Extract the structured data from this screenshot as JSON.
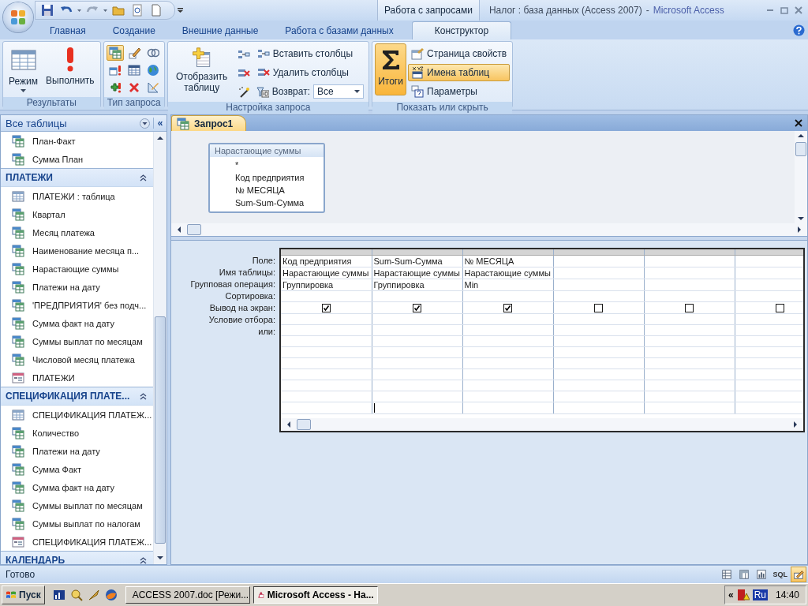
{
  "window": {
    "title": "Налог : база данных (Access 2007)",
    "separator": "-",
    "app": "Microsoft Access"
  },
  "context_group": "Работа с запросами",
  "tabs": [
    {
      "label": "Главная",
      "selected": false
    },
    {
      "label": "Создание",
      "selected": false
    },
    {
      "label": "Внешние данные",
      "selected": false
    },
    {
      "label": "Работа с базами данных",
      "selected": false
    },
    {
      "label": "Конструктор",
      "selected": true
    }
  ],
  "ribbon": [
    {
      "title": "Результаты",
      "controls": [
        {
          "kind": "large",
          "label": "Режим",
          "dropdown": true,
          "selected": false
        },
        {
          "kind": "large",
          "label": "Выполнить",
          "selected": false
        }
      ]
    },
    {
      "title": "Тип запроса",
      "controls": [
        {
          "kind": "icongrid",
          "items": [
            {
              "selected": true
            },
            {
              "selected": false
            },
            {
              "selected": false
            },
            {
              "selected": false
            },
            {
              "selected": false
            },
            {
              "selected": false
            },
            {
              "selected": false
            },
            {
              "selected": false
            },
            {
              "selected": false
            }
          ]
        }
      ]
    },
    {
      "title": "Настройка запроса",
      "controls": [
        {
          "kind": "large",
          "label": "Отобразить таблицу",
          "selected": false
        },
        {
          "kind": "iconcol",
          "items": [
            {
              "selected": false
            },
            {
              "selected": false
            },
            {
              "selected": false
            }
          ]
        },
        {
          "kind": "stack",
          "items": [
            {
              "kind": "small",
              "label": "Вставить столбцы",
              "selected": false
            },
            {
              "kind": "small",
              "label": "Удалить столбцы",
              "selected": false
            },
            {
              "kind": "combo",
              "label": "Возврат:",
              "value": "Все"
            }
          ]
        }
      ]
    },
    {
      "title": "Показать или скрыть",
      "controls": [
        {
          "kind": "large",
          "label": "Итоги",
          "selected": true
        },
        {
          "kind": "stack",
          "items": [
            {
              "kind": "small",
              "label": "Страница свойств",
              "selected": false
            },
            {
              "kind": "small",
              "label": "Имена таблиц",
              "selected": true
            },
            {
              "kind": "small",
              "label": "Параметры",
              "selected": false
            }
          ]
        }
      ]
    }
  ],
  "nav": {
    "header": "Все таблицы",
    "collapse": "«",
    "groups": [
      {
        "items": [
          {
            "label": "План-Факт",
            "kind": "query"
          },
          {
            "label": "Сумма План",
            "kind": "query"
          }
        ]
      },
      {
        "title": "ПЛАТЕЖИ",
        "expanded": true,
        "items": [
          {
            "label": "ПЛАТЕЖИ : таблица",
            "kind": "table"
          },
          {
            "label": "Квартал",
            "kind": "query"
          },
          {
            "label": "Месяц платежа",
            "kind": "query"
          },
          {
            "label": "Наименование месяца п...",
            "kind": "query"
          },
          {
            "label": "Нарастающие суммы",
            "kind": "query"
          },
          {
            "label": "Платежи на дату",
            "kind": "query"
          },
          {
            "label": "'ПРЕДПРИЯТИЯ' без подч...",
            "kind": "query"
          },
          {
            "label": "Сумма факт на дату",
            "kind": "query"
          },
          {
            "label": "Суммы выплат по месяцам",
            "kind": "query"
          },
          {
            "label": "Числовой месяц платежа",
            "kind": "query"
          },
          {
            "label": "ПЛАТЕЖИ",
            "kind": "form"
          }
        ]
      },
      {
        "title": "СПЕЦИФИКАЦИЯ ПЛАТЕ...",
        "expanded": true,
        "items": [
          {
            "label": "СПЕЦИФИКАЦИЯ ПЛАТЕЖ...",
            "kind": "table"
          },
          {
            "label": "Количество",
            "kind": "query"
          },
          {
            "label": "Платежи на дату",
            "kind": "query"
          },
          {
            "label": "Сумма Факт",
            "kind": "query"
          },
          {
            "label": "Сумма факт на дату",
            "kind": "query"
          },
          {
            "label": "Суммы выплат по месяцам",
            "kind": "query"
          },
          {
            "label": "Суммы выплат по налогам",
            "kind": "query"
          },
          {
            "label": "СПЕЦИФИКАЦИЯ ПЛАТЕЖ...",
            "kind": "form"
          }
        ]
      },
      {
        "title": "КАЛЕНДАРЬ",
        "expanded": true
      }
    ]
  },
  "document": {
    "tab": {
      "label": "Запрос1",
      "selected": true
    },
    "field_list": {
      "title": "Нарастающие суммы",
      "fields": [
        "*",
        "Код предприятия",
        "№ МЕСЯЦА",
        "Sum-Sum-Сумма"
      ]
    },
    "grid": {
      "row_labels": [
        "Поле:",
        "Имя таблицы:",
        "Групповая операция:",
        "Сортировка:",
        "Вывод на экран:",
        "Условие отбора:",
        "или:"
      ],
      "columns": [
        {
          "field": "Код предприятия",
          "table": "Нарастающие суммы",
          "total": "Группировка",
          "show": true
        },
        {
          "field": "Sum-Sum-Сумма",
          "table": "Нарастающие суммы",
          "total": "Группировка",
          "show": true
        },
        {
          "field": "№ МЕСЯЦА",
          "table": "Нарастающие суммы",
          "total": "Min",
          "show": true
        },
        {
          "show": false
        },
        {
          "show": false
        },
        {
          "show": false
        }
      ]
    }
  },
  "status_bar": {
    "text": "Готово",
    "views": [
      {
        "kind": "icon",
        "selected": false
      },
      {
        "kind": "icon",
        "selected": false
      },
      {
        "kind": "icon",
        "selected": false
      },
      {
        "kind": "text",
        "label": "SQL",
        "selected": false
      },
      {
        "kind": "icon",
        "selected": true
      }
    ]
  },
  "taskbar": {
    "start": "Пуск",
    "tasks": [
      {
        "label": "ACCESS 2007.doc [Режи...",
        "selected": false
      },
      {
        "label": "Microsoft Access - На...",
        "selected": true
      }
    ],
    "tray": {
      "collapse": "«",
      "language": "Ru",
      "time": "14:40"
    }
  }
}
